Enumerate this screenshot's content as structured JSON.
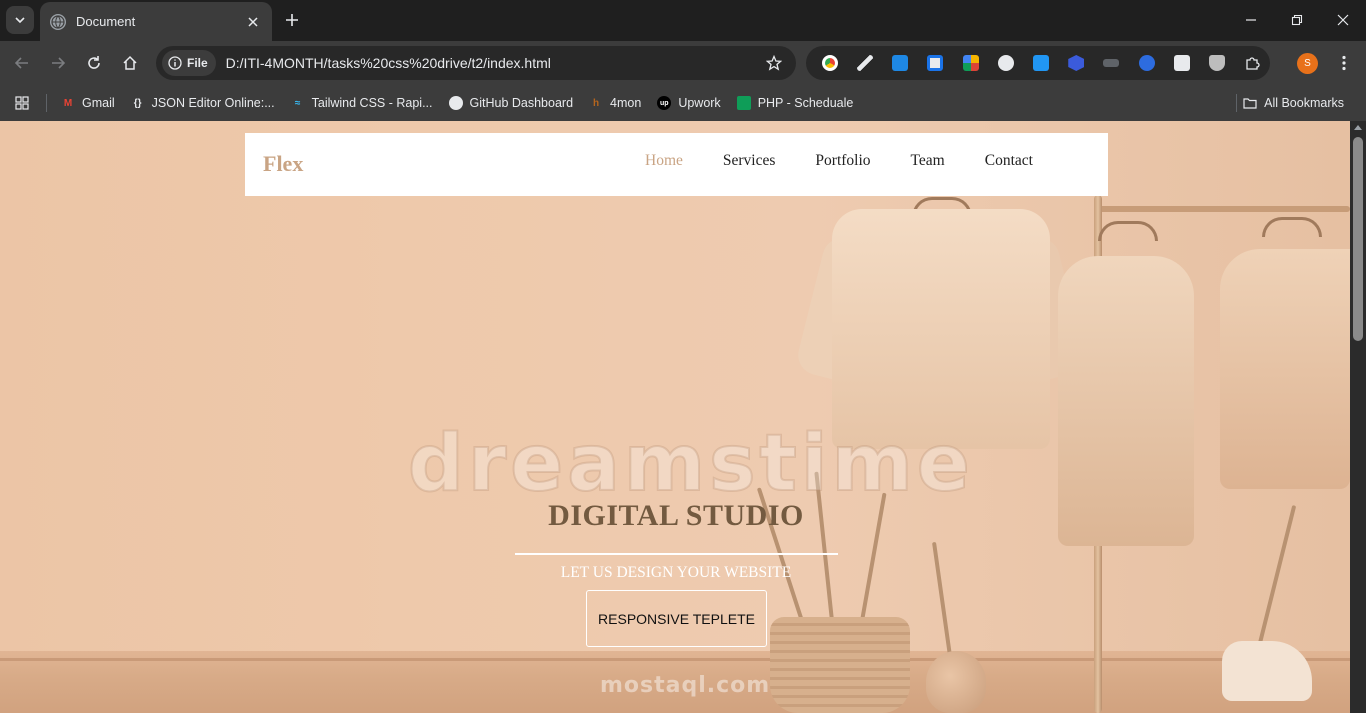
{
  "browser": {
    "tab": {
      "title": "Document"
    },
    "address": {
      "chip_label": "File",
      "url": "D:/ITI-4MONTH/tasks%20css%20drive/t2/index.html"
    },
    "profile_initial": "S",
    "extensions": [
      "chrome-ext-icon",
      "color-picker-icon",
      "fi-ext-icon",
      "search-ext-icon",
      "grid-ext-icon",
      "dots-ext-icon",
      "download-ext-icon",
      "hex-ext-icon",
      "car-ext-icon",
      "zm-ext-icon",
      "diamond-ext-icon",
      "shield-ext-icon",
      "puzzle-icon"
    ]
  },
  "bookmarks": {
    "items": [
      {
        "label": "Gmail",
        "icon": "gmail-icon"
      },
      {
        "label": "JSON Editor Online:...",
        "icon": "braces-icon"
      },
      {
        "label": "Tailwind CSS - Rapi...",
        "icon": "tailwind-icon"
      },
      {
        "label": "GitHub Dashboard",
        "icon": "github-icon"
      },
      {
        "label": "4mon",
        "icon": "bookmark-4mon-icon"
      },
      {
        "label": "Upwork",
        "icon": "upwork-icon"
      },
      {
        "label": "PHP - Scheduale",
        "icon": "sheets-icon"
      }
    ],
    "all_label": "All Bookmarks"
  },
  "page": {
    "brand": "Flex",
    "nav": [
      "Home",
      "Services",
      "Portfolio",
      "Team",
      "Contact"
    ],
    "hero": {
      "title": "DIGITAL STUDIO",
      "subtitle": "LET US DESIGN YOUR WEBSITE",
      "button": "RESPONSIVE TEPLETE"
    },
    "watermark": "dreamstime",
    "watermark2": "mostaql.com"
  },
  "colors": {
    "accent": "#c9a484",
    "title": "#735a40"
  }
}
